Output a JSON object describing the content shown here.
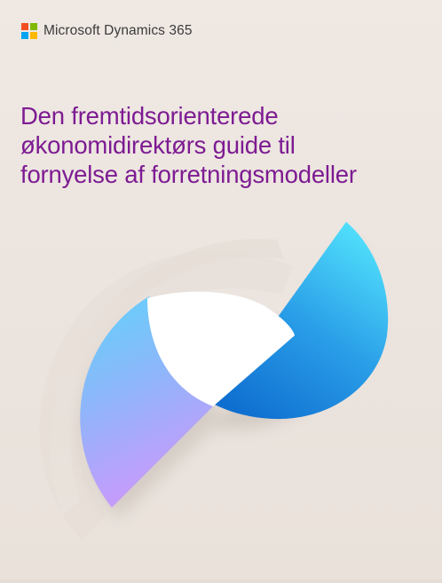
{
  "brand": {
    "name": "Microsoft Dynamics 365",
    "logo_colors": [
      "#f25022",
      "#7fba00",
      "#00a4ef",
      "#ffb900"
    ]
  },
  "document": {
    "title_lines": [
      "Den fremtidsorienterede",
      "økonomidirektørs guide til",
      "fornyelse af forretningsmodeller"
    ],
    "title_color": "#7d1b92"
  }
}
